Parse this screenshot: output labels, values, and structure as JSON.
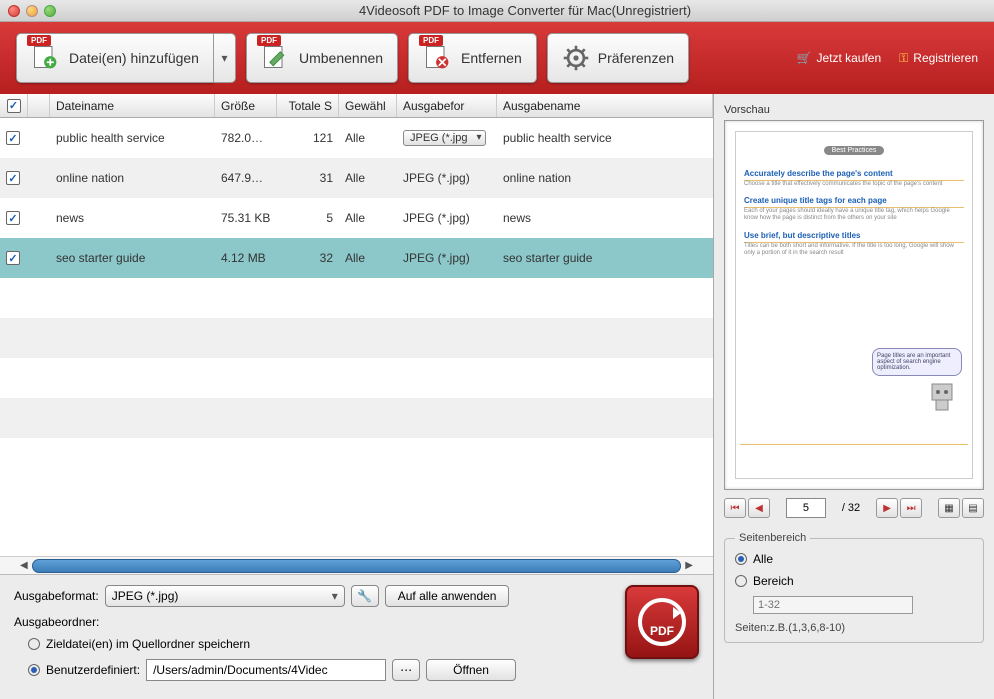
{
  "window": {
    "title": "4Videosoft PDF to Image Converter für Mac(Unregistriert)"
  },
  "toolbar": {
    "add": "Datei(en) hinzufügen",
    "rename": "Umbenennen",
    "remove": "Entfernen",
    "prefs": "Präferenzen",
    "buy": "Jetzt kaufen",
    "register": "Registrieren"
  },
  "columns": {
    "name": "Dateiname",
    "size": "Größe",
    "total": "Totale S",
    "selected": "Gewähl",
    "format": "Ausgabefor",
    "output": "Ausgabename"
  },
  "rows": [
    {
      "checked": true,
      "name": "public health service",
      "size": "782.0…",
      "total": "121",
      "sel": "Alle",
      "fmt": "JPEG (*.jpg",
      "fmt_dropdown": true,
      "out": "public health service"
    },
    {
      "checked": true,
      "name": "online nation",
      "size": "647.9…",
      "total": "31",
      "sel": "Alle",
      "fmt": "JPEG (*.jpg)",
      "out": "online nation"
    },
    {
      "checked": true,
      "name": "news",
      "size": "75.31 KB",
      "total": "5",
      "sel": "Alle",
      "fmt": "JPEG (*.jpg)",
      "out": "news"
    },
    {
      "checked": true,
      "name": "seo starter guide",
      "size": "4.12 MB",
      "total": "32",
      "sel": "Alle",
      "fmt": "JPEG (*.jpg)",
      "out": "seo starter guide",
      "selected": true
    }
  ],
  "output": {
    "format_label": "Ausgabeformat:",
    "format_value": "JPEG (*.jpg)",
    "apply_all": "Auf alle anwenden",
    "folder_label": "Ausgabeordner:",
    "opt_source": "Zieldatei(en) im Quellordner speichern",
    "opt_custom": "Benutzerdefiniert:",
    "path": "/Users/admin/Documents/4Videc",
    "open": "Öffnen"
  },
  "preview": {
    "title": "Vorschau",
    "page": "5",
    "total": "/ 32",
    "doc": {
      "pill": "Best Practices",
      "h1": "Accurately describe the page's content",
      "t1": "Choose a title that effectively communicates the topic of the page's content",
      "h2": "Create unique title tags for each page",
      "t2": "Each of your pages should ideally have a unique title tag, which helps Google know how the page is distinct from the others on your site",
      "h3": "Use brief, but descriptive titles",
      "t3": "Titles can be both short and informative. If the title is too long, Google will show only a portion of it in the search result",
      "bubble": "Page titles are an important aspect of search engine optimization."
    }
  },
  "range": {
    "legend": "Seitenbereich",
    "all": "Alle",
    "range": "Bereich",
    "placeholder": "1-32",
    "hint": "Seiten:z.B.(1,3,6,8-10)"
  }
}
